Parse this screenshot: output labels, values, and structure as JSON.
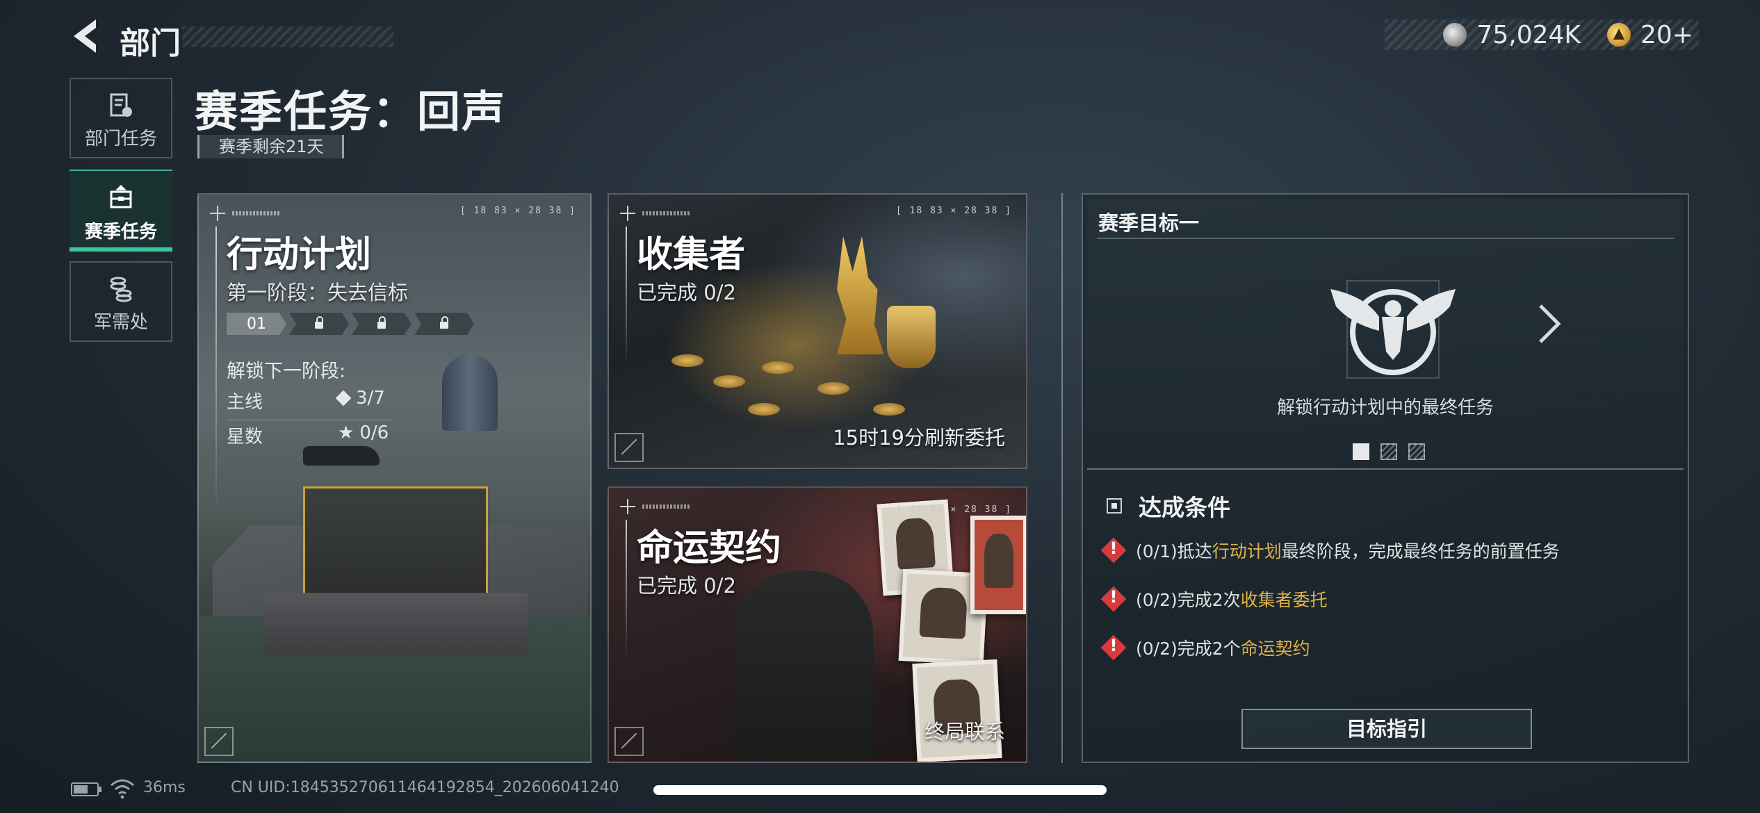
{
  "topbar": {
    "title": "部门",
    "currency_silver": "75,024K",
    "currency_gold": "20+"
  },
  "sidebar": {
    "items": [
      {
        "label": "部门任务",
        "icon": "task-document-icon"
      },
      {
        "label": "赛季任务",
        "icon": "season-briefcase-icon",
        "active": true
      },
      {
        "label": "军需处",
        "icon": "coins-stack-icon"
      }
    ]
  },
  "header": {
    "title": "赛季任务：回声",
    "season_left": "赛季剩余21天"
  },
  "cards": {
    "operation": {
      "title": "行动计划",
      "stage": "第一阶段：失去信标",
      "progress_first": "01",
      "progress_total_segments": 4,
      "progress_unlocked": 1,
      "unlock_title": "解锁下一阶段:",
      "main_label": "主线",
      "main_value": "3/7",
      "stars_label": "星数",
      "stars_value": "0/6",
      "coords": "[ 18 83 × 28 38 ]"
    },
    "collector": {
      "title": "收集者",
      "completed": "已完成 0/2",
      "refresh": "15时19分刷新委托",
      "coords": "[ 18 83 × 28 38 ]"
    },
    "fate": {
      "title": "命运契约",
      "completed": "已完成 0/2",
      "footer": "终局联系",
      "coords": "[ 18 83 × 28 38 ]"
    }
  },
  "goal": {
    "title": "赛季目标一",
    "description": "解锁行动计划中的最终任务",
    "pages": 3,
    "active_page": 1
  },
  "conditions": {
    "title": "达成条件",
    "items": [
      {
        "prefix": "(0/1)抵达",
        "highlight": "行动计划",
        "suffix": "最终阶段，完成最终任务的前置任务"
      },
      {
        "prefix": "(0/2)完成2次",
        "highlight": "收集者委托",
        "suffix": ""
      },
      {
        "prefix": "(0/2)完成2个",
        "highlight": "命运契约",
        "suffix": ""
      }
    ],
    "button": "目标指引"
  },
  "footer": {
    "ping": "36ms",
    "uid": "CN UID:18453527061146419285​4_202606041240"
  },
  "colors": {
    "accent_green": "#39c89e",
    "highlight_gold": "#e2b248",
    "warning_red": "#d93b3b"
  }
}
